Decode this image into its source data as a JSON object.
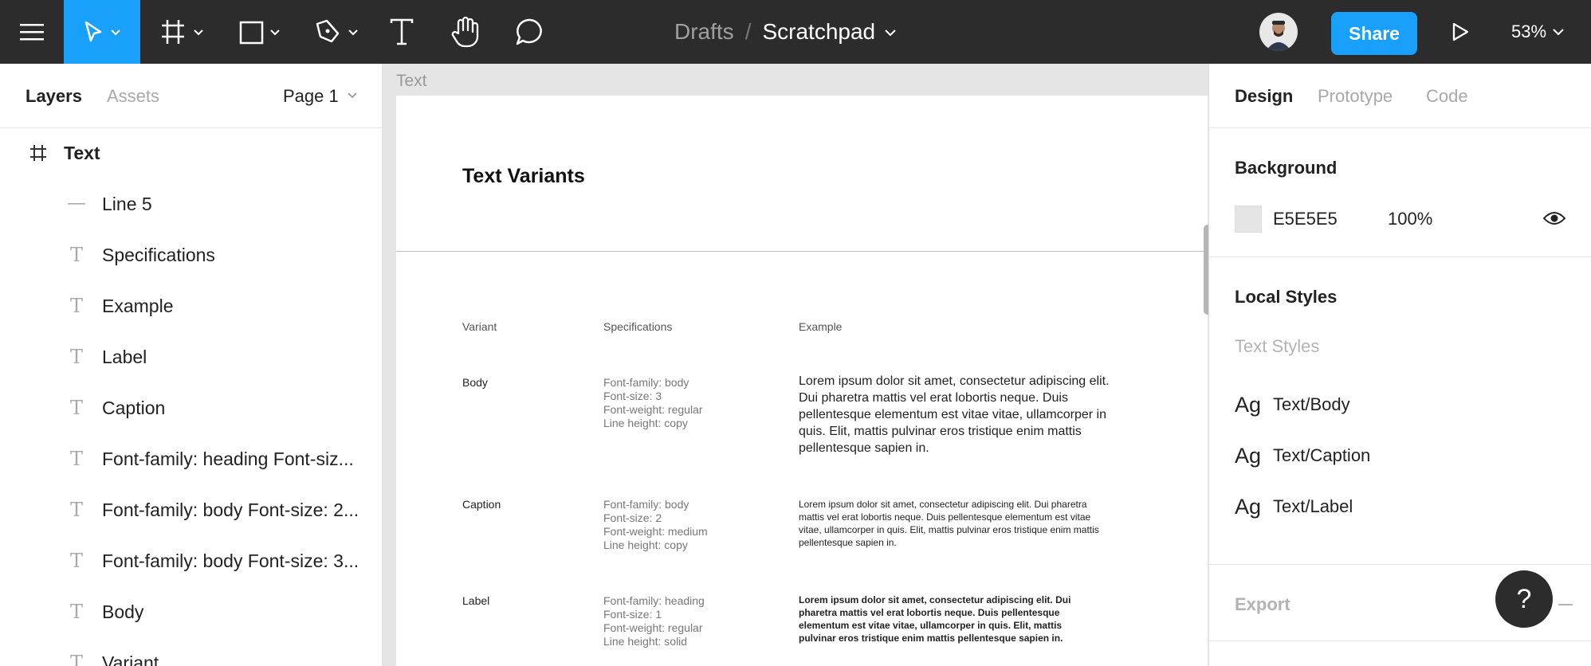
{
  "topbar": {
    "breadcrumb": {
      "folder": "Drafts",
      "separator": "/",
      "file": "Scratchpad"
    },
    "share_label": "Share",
    "zoom": "53%",
    "icons": [
      "menu-icon",
      "move-tool-icon",
      "frame-tool-icon",
      "rectangle-tool-icon",
      "pen-tool-icon",
      "text-tool-icon",
      "hand-tool-icon",
      "comment-tool-icon",
      "play-icon"
    ],
    "accent": "#18a0fb"
  },
  "left": {
    "tabs": {
      "layers": "Layers",
      "assets": "Assets",
      "page": "Page 1"
    },
    "layers": [
      {
        "name": "Text",
        "icon": "frame-icon"
      },
      {
        "name": "Line 5",
        "icon": "line-icon"
      },
      {
        "name": "Specifications",
        "icon": "text-icon"
      },
      {
        "name": "Example",
        "icon": "text-icon"
      },
      {
        "name": "Label",
        "icon": "text-icon"
      },
      {
        "name": "Caption",
        "icon": "text-icon"
      },
      {
        "name": "Font-family: heading Font-siz...",
        "icon": "text-icon"
      },
      {
        "name": "Font-family: body Font-size: 2...",
        "icon": "text-icon"
      },
      {
        "name": "Font-family: body Font-size: 3...",
        "icon": "text-icon"
      },
      {
        "name": "Body",
        "icon": "text-icon"
      },
      {
        "name": "Variant",
        "icon": "text-icon"
      }
    ]
  },
  "canvas": {
    "frame_label": "Text",
    "title": "Text Variants",
    "headers": {
      "variant": "Variant",
      "specifications": "Specifications",
      "example": "Example"
    },
    "rows": [
      {
        "variant": "Body",
        "specs": [
          "Font-family: body",
          "Font-size: 3",
          "Font-weight: regular",
          "Line height: copy"
        ],
        "example": "Lorem ipsum dolor sit amet, consectetur adipiscing elit. Dui pharetra mattis vel erat lobortis neque. Duis pellentesque elementum est vitae vitae, ullamcorper in quis. Elit, mattis pulvinar eros tristique enim mattis pellentesque sapien in."
      },
      {
        "variant": "Caption",
        "specs": [
          "Font-family: body",
          "Font-size: 2",
          "Font-weight: medium",
          "Line height: copy"
        ],
        "example": "Lorem ipsum dolor sit amet, consectetur adipiscing elit. Dui pharetra mattis vel erat lobortis neque. Duis pellentesque elementum est vitae vitae, ullamcorper in quis. Elit, mattis pulvinar eros tristique enim mattis pellentesque sapien in."
      },
      {
        "variant": "Label",
        "specs": [
          "Font-family: heading",
          "Font-size: 1",
          "Font-weight: regular",
          "Line height: solid"
        ],
        "example": "Lorem ipsum dolor sit amet, consectetur adipiscing elit. Dui pharetra mattis vel erat lobortis neque. Duis pellentesque elementum est vitae vitae, ullamcorper in quis. Elit, mattis pulvinar eros tristique enim mattis pellentesque sapien in."
      }
    ]
  },
  "right": {
    "tabs": {
      "design": "Design",
      "prototype": "Prototype",
      "code": "Code"
    },
    "background": {
      "title": "Background",
      "hex": "E5E5E5",
      "opacity": "100%",
      "color": "#e5e5e5"
    },
    "local_styles": {
      "title": "Local Styles",
      "subtitle": "Text Styles",
      "items": [
        {
          "ag": "Ag",
          "name": "Text/Body"
        },
        {
          "ag": "Ag",
          "name": "Text/Caption"
        },
        {
          "ag": "Ag",
          "name": "Text/Label"
        }
      ]
    },
    "export": "Export",
    "help": "?"
  }
}
